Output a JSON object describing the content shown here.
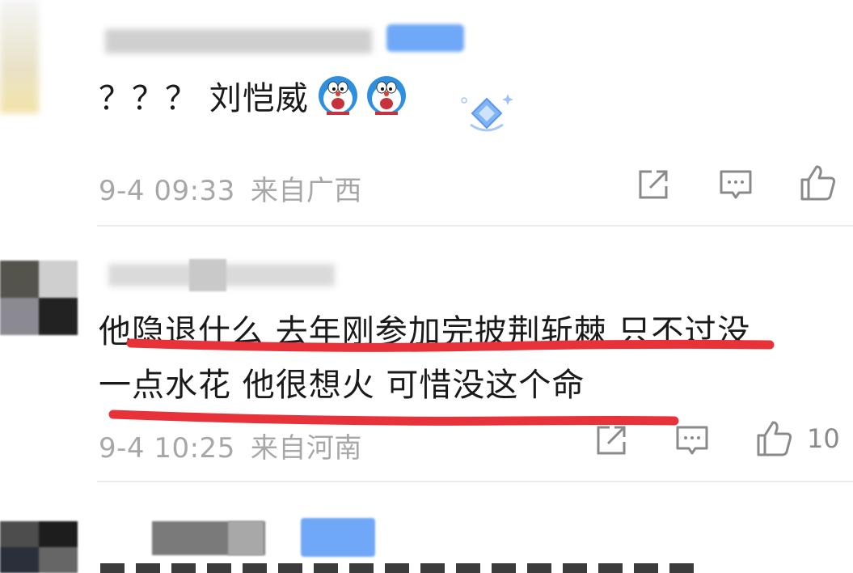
{
  "comments": [
    {
      "text": "？？？ 刘恺威",
      "emojis": [
        "doraemon-emoji",
        "doraemon-emoji"
      ],
      "badge_icon": "diamond-badge-icon",
      "time": "9-4 09:33",
      "location": "来自广西"
    },
    {
      "text_line1": "他隐退什么 去年刚参加完披荆斩棘 只不过没",
      "text_line2": "一点水花 他很想火 可惜没这个命",
      "time": "9-4 10:25",
      "location": "来自河南",
      "likes": "10",
      "annotation_color": "#e8323a"
    }
  ],
  "actions": [
    "share-icon",
    "comment-icon",
    "like-icon"
  ],
  "colors": {
    "meta": "#a7a7a7",
    "text": "#1a1a1a",
    "underline": "#e8323a",
    "level_badge": "#6fa8f7"
  }
}
